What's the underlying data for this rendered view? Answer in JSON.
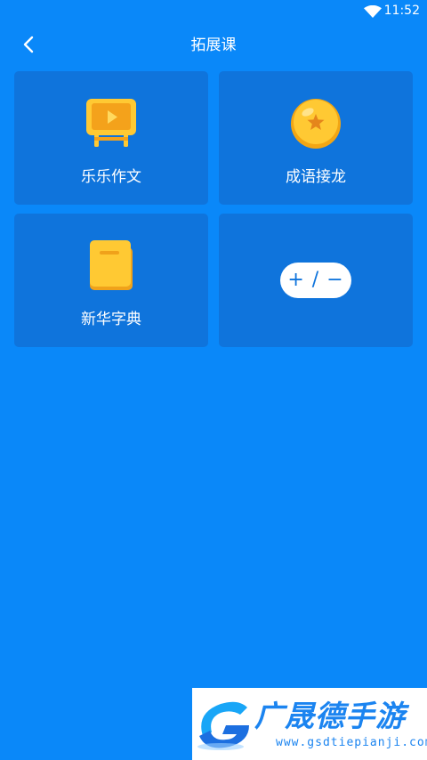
{
  "status_bar": {
    "time": "11:52",
    "icons": [
      "wifi-icon"
    ]
  },
  "header": {
    "title": "拓展课",
    "back_icon": "chevron-left-icon"
  },
  "colors": {
    "background": "#0A88F9",
    "card": "#0F74DC",
    "text": "#FFFFFF",
    "icon_yellow": "#FFC933"
  },
  "courses": [
    {
      "label": "乐乐作文",
      "icon": "tv-easel-icon"
    },
    {
      "label": "成语接龙",
      "icon": "dragon-ball-icon"
    },
    {
      "label": "新华字典",
      "icon": "book-icon"
    },
    {
      "label": "",
      "icon": "add-remove",
      "pill_text": "+ / −"
    }
  ],
  "watermark": {
    "name": "广晟德手游",
    "url": "www.gsdtiepianji.com",
    "logo_icon": "g-logo-icon"
  }
}
